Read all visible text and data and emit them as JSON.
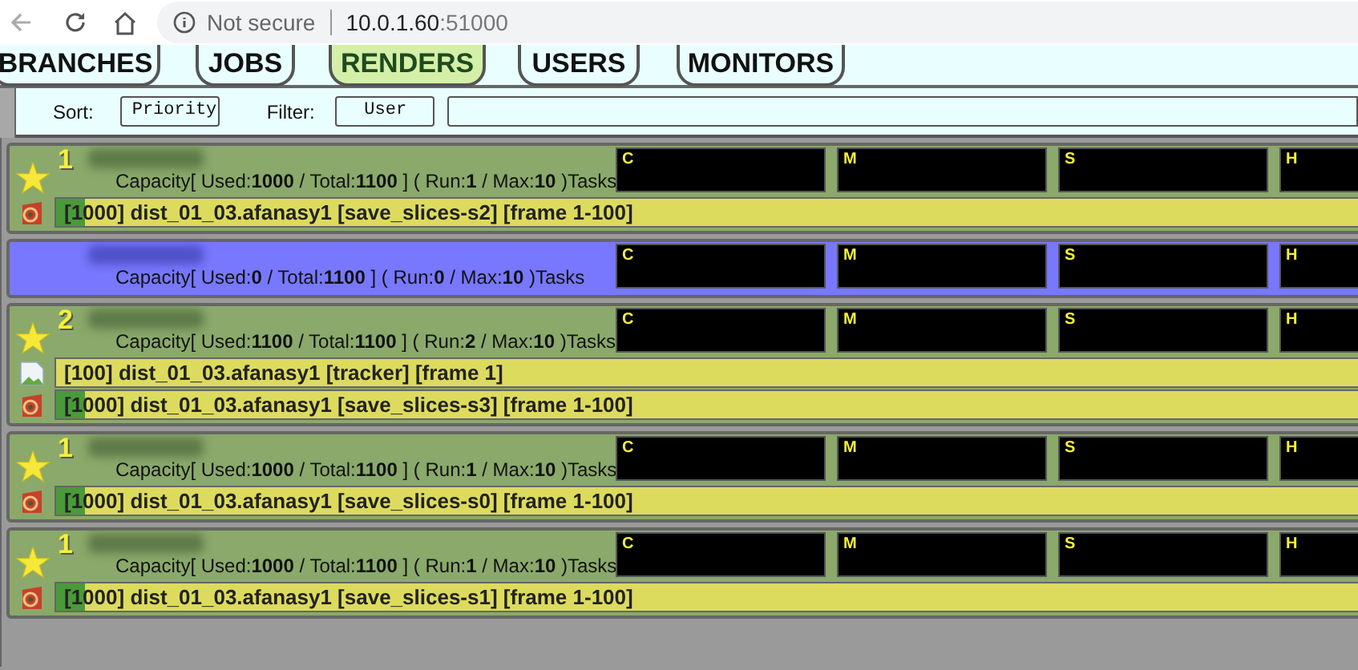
{
  "browser": {
    "security": "Not secure",
    "host": "10.0.1.60",
    "port": ":51000"
  },
  "tabs": [
    {
      "label": "BRANCHES",
      "selected": false
    },
    {
      "label": "JOBS",
      "selected": false
    },
    {
      "label": "RENDERS",
      "selected": true
    },
    {
      "label": "USERS",
      "selected": false
    },
    {
      "label": "MONITORS",
      "selected": false
    }
  ],
  "toolbar": {
    "sort_label": "Sort:",
    "sort_value": "Priority",
    "filter_label": "Filter:",
    "filter_value": "User"
  },
  "renders": [
    {
      "kind": "busy",
      "priority": "1",
      "capacity": "Capacity[ Used:**1000** / Total:**1100** ] ( Run:**1** / Max:**10** )Tasks",
      "graphs": [
        "C",
        "M",
        "S",
        "H"
      ],
      "tasks": [
        {
          "kind": "service",
          "text": "[1000] dist_01_03.afanasy1 [save_slices-s2] [frame 1-100]",
          "level": 0.02
        }
      ]
    },
    {
      "kind": "free",
      "capacity": "Capacity[ Used:**0** / Total:**1100** ] ( Run:**0** / Max:**10** )Tasks",
      "graphs": [
        "C",
        "M",
        "S",
        "H"
      ]
    },
    {
      "kind": "busy",
      "priority": "2",
      "capacity": "Capacity[ Used:**1100** / Total:**1100** ] ( Run:**2** / Max:**10** )Tasks",
      "graphs": [
        "C",
        "M",
        "S",
        "H"
      ],
      "tasks": [
        {
          "kind": "missing-icon",
          "text": "[100] dist_01_03.afanasy1 [tracker] [frame 1]"
        },
        {
          "kind": "service",
          "text": "[1000] dist_01_03.afanasy1 [save_slices-s3] [frame 1-100]",
          "level": 0.02
        }
      ]
    },
    {
      "kind": "busy",
      "priority": "1",
      "capacity": "Capacity[ Used:**1000** / Total:**1100** ] ( Run:**1** / Max:**10** )Tasks",
      "graphs": [
        "C",
        "M",
        "S",
        "H"
      ],
      "tasks": [
        {
          "kind": "service",
          "text": "[1000] dist_01_03.afanasy1 [save_slices-s0] [frame 1-100]",
          "level": 0.02
        }
      ]
    },
    {
      "kind": "busy",
      "priority": "1",
      "capacity": "Capacity[ Used:**1000** / Total:**1100** ] ( Run:**1** / Max:**10** )Tasks",
      "graphs": [
        "C",
        "M",
        "S",
        "H"
      ],
      "tasks": [
        {
          "kind": "service",
          "text": "[1000] dist_01_03.afanasy1 [save_slices-s1] [frame 1-100]",
          "level": 0.02
        }
      ]
    }
  ]
}
